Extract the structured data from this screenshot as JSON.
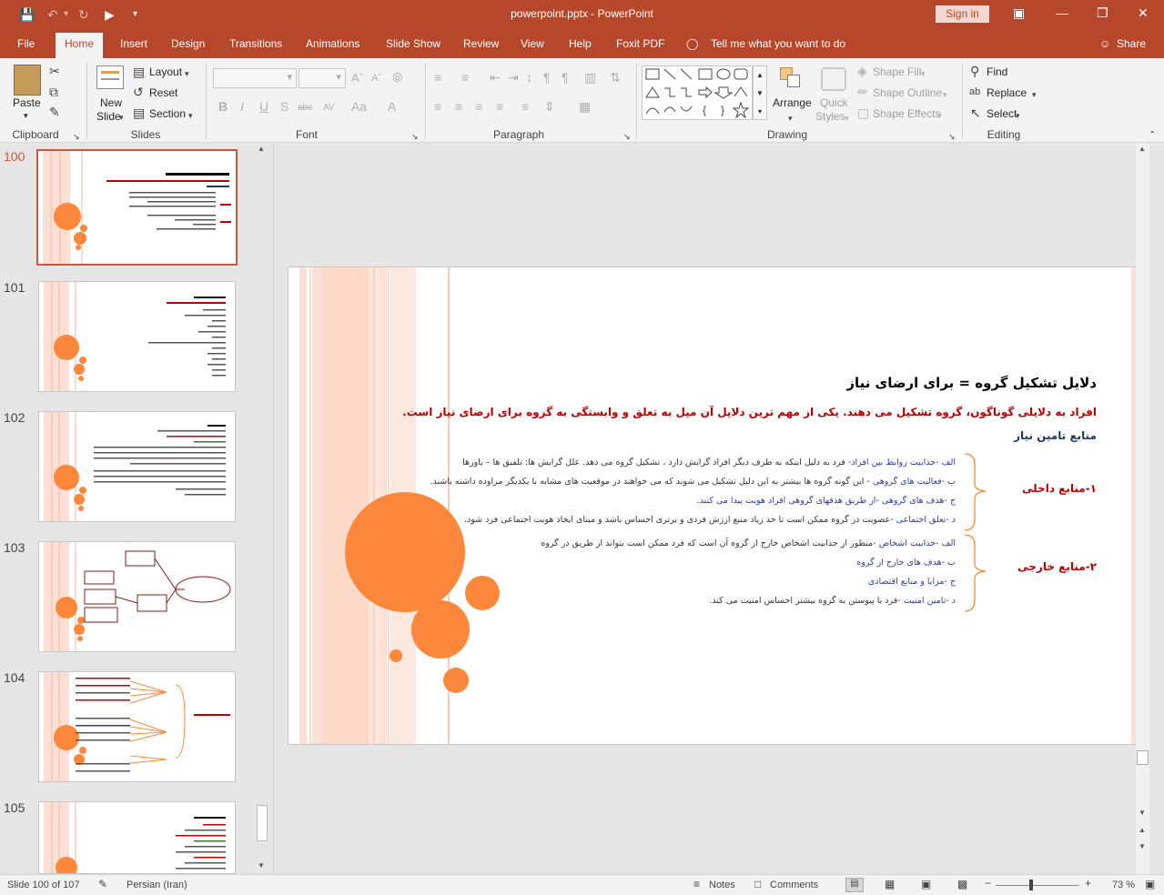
{
  "window": {
    "title": "powerpoint.pptx  -  PowerPoint",
    "signin": "Sign in"
  },
  "tabs": [
    "File",
    "Home",
    "Insert",
    "Design",
    "Transitions",
    "Animations",
    "Slide Show",
    "Review",
    "View",
    "Help",
    "Foxit PDF"
  ],
  "tell_me": "Tell me what you want to do",
  "share": "Share",
  "ribbon": {
    "clipboard": {
      "label": "Clipboard",
      "paste": "Paste"
    },
    "slides": {
      "label": "Slides",
      "new_slide_1": "New",
      "new_slide_2": "Slide",
      "layout": "Layout",
      "reset": "Reset",
      "section": "Section"
    },
    "font": {
      "label": "Font"
    },
    "paragraph": {
      "label": "Paragraph"
    },
    "drawing": {
      "label": "Drawing",
      "arrange": "Arrange",
      "quick_styles_1": "Quick",
      "quick_styles_2": "Styles",
      "shape_fill": "Shape Fill",
      "shape_outline": "Shape Outline",
      "shape_effects": "Shape Effects"
    },
    "editing": {
      "label": "Editing",
      "find": "Find",
      "replace": "Replace",
      "select": "Select"
    }
  },
  "thumbnails": [
    {
      "num": "100",
      "selected": true
    },
    {
      "num": "101",
      "selected": false
    },
    {
      "num": "102",
      "selected": false
    },
    {
      "num": "103",
      "selected": false
    },
    {
      "num": "104",
      "selected": false
    },
    {
      "num": "105",
      "selected": false
    }
  ],
  "slide": {
    "title": "دلایل تشکیل گروه = برای ارضای نیاز",
    "subtitle": "افراد به دلایلی گوناگون، گروه تشکیل می دهند. یکی از مهم ترین دلایل آن میل به تعلق و وابستگی به گروه برای ارضای نیاز است.",
    "sources_heading": "منابع تامین نیاز",
    "internal_label": "۱-منابع داخلی",
    "external_label": "۲-منابع خارجی",
    "internal_items": [
      {
        "head": "الف -جذابیت روابط بین افراد-",
        "body": " فرد به دلیل اینکه به طرف دیگر افراد گرایش دارد ، تشکیل گروه می دهد. علل گرایش ها: تلفیق ها – باورها"
      },
      {
        "head": "ب -فعالیت های گروهی -",
        "body": " این گونه گروه ها بیشتر به این دلیل تشکیل می شوند که می خواهند در موقعیت های مشابه با یکدیگر مراوده داشته باشند."
      },
      {
        "head": "ج -هدف های گروهی -",
        "body": "از طریق هدفهای گروهی افراد هویت پیدا می کنند."
      },
      {
        "head": "د -تعلق اجتماعی -",
        "body": "عضویت در گروه ممکن است تا حد زیاد منبع ارزش فردی و برتری احساس باشد و مبنای ایجاد هویت اجتماعی فرد شود."
      }
    ],
    "external_items": [
      {
        "head": "الف -جذابیت اشخاص -",
        "body": "منظور از جذابیت اشخاص خارج از گروه آن است که فرد ممکن است بتواند از طریق در گروه"
      },
      {
        "head": "ب -هدف های خارج از گروه",
        "body": ""
      },
      {
        "head": "ج -مزایا و منابع اقتصادی",
        "body": ""
      },
      {
        "head": "د -تامین امنیت -",
        "body": "فرد با پیوستن به گروه بیشتر احساس امنیت می کند."
      }
    ]
  },
  "status": {
    "slide_of": "Slide 100 of 107",
    "language": "Persian (Iran)",
    "notes": "Notes",
    "comments": "Comments",
    "zoom": "73 %"
  },
  "colors": {
    "brand": "#b7472a",
    "accent_orange": "#fd873a",
    "title_red": "#c00000",
    "navy": "#1f3864",
    "blue_text": "#2e3c9b"
  }
}
